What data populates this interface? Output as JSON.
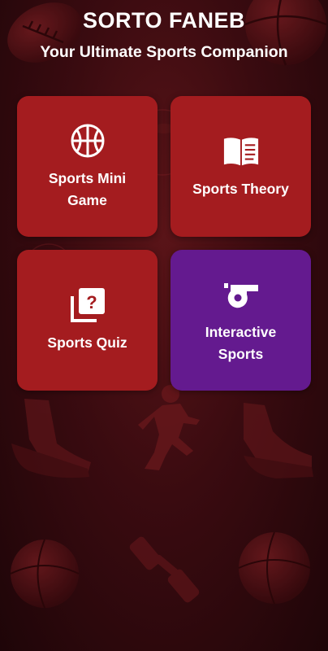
{
  "app": {
    "title": "SORTO FANEB",
    "subtitle": "Your Ultimate Sports Companion"
  },
  "cards": [
    {
      "label": "Sports Mini Game",
      "icon": "basketball-icon",
      "color": "#a41c1f"
    },
    {
      "label": "Sports Theory",
      "icon": "open-book-icon",
      "color": "#a41c1f"
    },
    {
      "label": "Sports Quiz",
      "icon": "quiz-question-icon",
      "color": "#a41c1f"
    },
    {
      "label": "Interactive Sports",
      "icon": "whistle-icon",
      "color": "#641a8f"
    }
  ],
  "background": {
    "description_icons": [
      "football-icon",
      "basketball-icon",
      "racket-icon",
      "sneaker-icon",
      "runner-icon",
      "dumbbell-icon"
    ],
    "base_color": "#3a0b10"
  }
}
